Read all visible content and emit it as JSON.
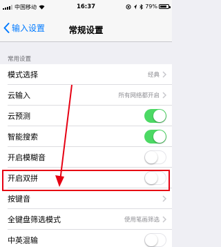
{
  "status_bar": {
    "carrier": "中国移动",
    "time": "16:37",
    "battery": "79%",
    "battery_level": 0.79
  },
  "nav": {
    "back_label": "输入设置",
    "title": "常规设置"
  },
  "section": {
    "header": "常用设置"
  },
  "rows": [
    {
      "label": "模式选择",
      "value": "经典",
      "type": "disclosure"
    },
    {
      "label": "云输入",
      "value": "所有网络都开启",
      "type": "disclosure"
    },
    {
      "label": "云预测",
      "type": "toggle",
      "on": true
    },
    {
      "label": "智能搜索",
      "type": "toggle",
      "on": true
    },
    {
      "label": "开启模糊音",
      "type": "toggle",
      "on": false
    },
    {
      "label": "开启双拼",
      "type": "toggle",
      "on": false
    },
    {
      "label": "按键音",
      "value": "",
      "type": "disclosure"
    },
    {
      "label": "全键盘筛选模式",
      "value": "使用笔画筛选",
      "type": "disclosure"
    },
    {
      "label": "中英混输",
      "type": "toggle",
      "on": false
    }
  ],
  "colors": {
    "accent": "#007aff",
    "toggle_on": "#4cd964",
    "annotation": "#e60012"
  }
}
